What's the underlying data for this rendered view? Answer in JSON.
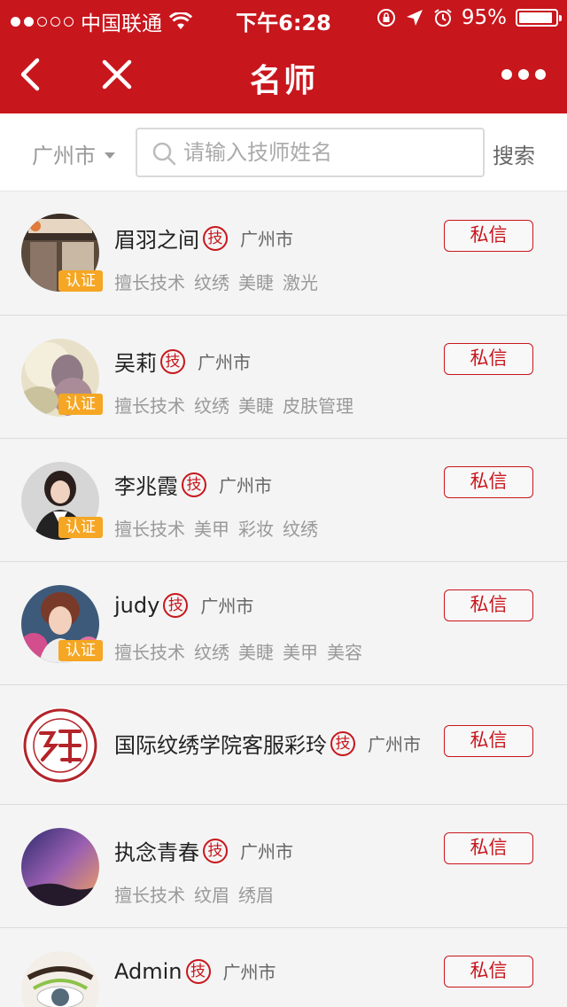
{
  "status_bar": {
    "carrier": "中国联通",
    "time": "下午6:28",
    "battery": "95%",
    "battery_level": 0.95,
    "signal_bars_filled": 2,
    "signal_bars_total": 5
  },
  "nav": {
    "title": "名师",
    "back_icon": "chevron-left-icon",
    "close_icon": "close-icon",
    "more_icon": "more-dots-icon"
  },
  "search": {
    "city": "广州市",
    "placeholder": "请输入技师姓名",
    "value": "",
    "button_label": "搜索"
  },
  "colors": {
    "brand_red": "#c8161d",
    "badge_orange": "#f5a623",
    "background": "#f4f4f4"
  },
  "list": {
    "items": [
      {
        "name": "眉羽之间",
        "tag": "技",
        "city": "广州市",
        "certified": true,
        "badge": "认证",
        "skills": [
          "擅长技术",
          "纹绣",
          "美睫",
          "激光"
        ],
        "message_label": "私信"
      },
      {
        "name": "吴莉",
        "tag": "技",
        "city": "广州市",
        "certified": true,
        "badge": "认证",
        "skills": [
          "擅长技术",
          "纹绣",
          "美睫",
          "皮肤管理"
        ],
        "message_label": "私信"
      },
      {
        "name": "李兆霞",
        "tag": "技",
        "city": "广州市",
        "certified": true,
        "badge": "认证",
        "skills": [
          "擅长技术",
          "美甲",
          "彩妆",
          "纹绣"
        ],
        "message_label": "私信"
      },
      {
        "name": "judy",
        "tag": "技",
        "city": "广州市",
        "certified": true,
        "badge": "认证",
        "skills": [
          "擅长技术",
          "纹绣",
          "美睫",
          "美甲",
          "美容"
        ],
        "message_label": "私信"
      },
      {
        "name": "国际纹绣学院客服彩玲",
        "tag": "技",
        "city": "广州市",
        "certified": false,
        "badge": "",
        "skills": [],
        "message_label": "私信"
      },
      {
        "name": "执念青春",
        "tag": "技",
        "city": "广州市",
        "certified": false,
        "badge": "",
        "skills": [
          "擅长技术",
          "纹眉",
          "绣眉"
        ],
        "message_label": "私信"
      },
      {
        "name": "Admin",
        "tag": "技",
        "city": "广州市",
        "certified": false,
        "badge": "",
        "skills": [],
        "message_label": "私信"
      }
    ]
  }
}
